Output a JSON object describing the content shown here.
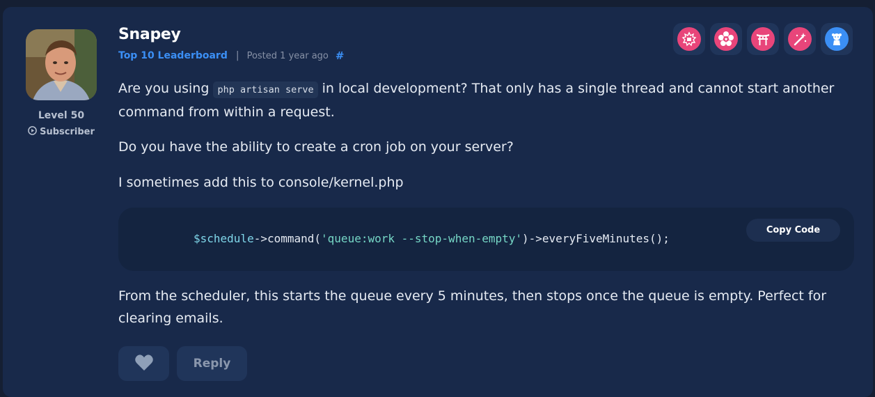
{
  "author": {
    "name": "Snapey",
    "rank_link": "Top 10 Leaderboard",
    "level": "Level 50",
    "subscriber": "Subscriber"
  },
  "meta": {
    "separator": "|",
    "posted": "Posted 1 year ago",
    "anchor": "#"
  },
  "badges": [
    {
      "icon": "emblem-badge-icon",
      "color": "#e8457a"
    },
    {
      "icon": "flower-badge-icon",
      "color": "#e8457a"
    },
    {
      "icon": "torii-gate-badge-icon",
      "color": "#e8457a"
    },
    {
      "icon": "magic-wand-badge-icon",
      "color": "#e8457a"
    },
    {
      "icon": "character-badge-icon",
      "color": "#3b8ff5"
    }
  ],
  "body": {
    "p1_before": "Are you using ",
    "p1_code": "php artisan serve",
    "p1_after": " in local development? That only has a single thread and cannot start another command from within a request.",
    "p2": "Do you have the ability to create a cron job on your server?",
    "p3": "I sometimes add this to console/kernel.php",
    "code": {
      "var": "$schedule",
      "mid": "->command(",
      "str": "'queue:work --stop-when-empty'",
      "end": ")->everyFiveMinutes();"
    },
    "copy_label": "Copy Code",
    "p4": "From the scheduler, this starts the queue every 5 minutes, then stops once the queue is empty. Perfect for clearing emails."
  },
  "actions": {
    "like_icon": "heart-icon",
    "reply_label": "Reply"
  },
  "colors": {
    "accent": "#3b8ff5",
    "badge_pink": "#e8457a",
    "card_bg": "#18294a"
  }
}
